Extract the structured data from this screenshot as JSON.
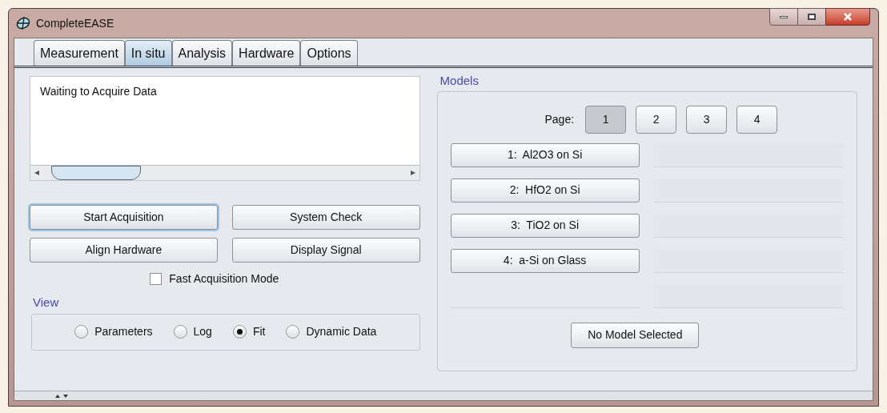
{
  "window": {
    "title": "CompleteEASE"
  },
  "tabs": [
    {
      "label": "Measurement",
      "selected": false
    },
    {
      "label": "In situ",
      "selected": true
    },
    {
      "label": "Analysis",
      "selected": false
    },
    {
      "label": "Hardware",
      "selected": false
    },
    {
      "label": "Options",
      "selected": false
    }
  ],
  "log": {
    "lines": [
      "Waiting to Acquire Data"
    ]
  },
  "actions": [
    {
      "label": "Start Acquisition",
      "focused": true
    },
    {
      "label": "System Check",
      "focused": false
    },
    {
      "label": "Align Hardware",
      "focused": false
    },
    {
      "label": "Display Signal",
      "focused": false
    }
  ],
  "fast_mode": {
    "label": "Fast Acquisition Mode",
    "checked": false
  },
  "view": {
    "title": "View",
    "options": [
      {
        "label": "Parameters",
        "selected": false
      },
      {
        "label": "Log",
        "selected": false
      },
      {
        "label": "Fit",
        "selected": true
      },
      {
        "label": "Dynamic Data",
        "selected": false
      }
    ]
  },
  "models": {
    "title": "Models",
    "page_label": "Page:",
    "pages": [
      {
        "label": "1",
        "selected": true
      },
      {
        "label": "2",
        "selected": false
      },
      {
        "label": "3",
        "selected": false
      },
      {
        "label": "4",
        "selected": false
      }
    ],
    "items": [
      "1:  Al2O3 on Si",
      "2:  HfO2 on Si",
      "3:  TiO2 on Si",
      "4:  a-Si on Glass"
    ],
    "status_button": "No Model Selected"
  }
}
